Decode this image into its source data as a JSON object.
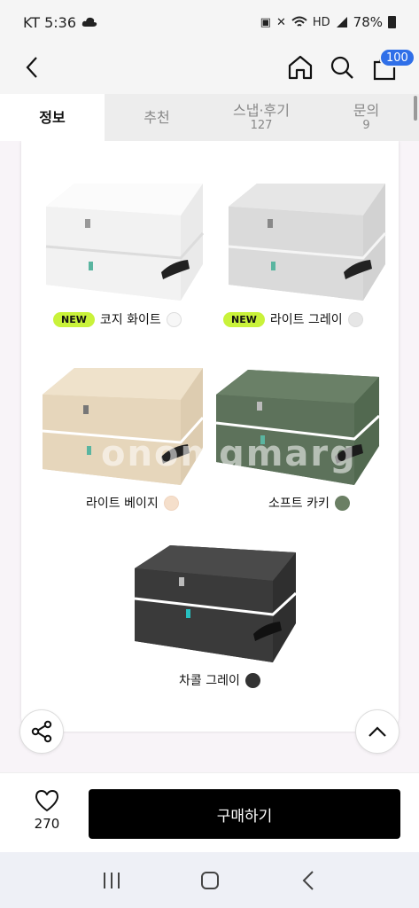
{
  "status": {
    "carrier_time": "KT 5:36",
    "battery_pct": "78%"
  },
  "header": {
    "cart_badge": "100"
  },
  "tabs": [
    {
      "label": "정보",
      "count": ""
    },
    {
      "label": "추천",
      "count": ""
    },
    {
      "label": "스냅·후기",
      "count": "127"
    },
    {
      "label": "문의",
      "count": "9"
    }
  ],
  "watermark": "onomgmarg",
  "products": [
    {
      "new": "NEW",
      "name": "코지 화이트",
      "color": "#f7f7f7",
      "body": "#f1f1f1",
      "top": "#fafafa"
    },
    {
      "new": "NEW",
      "name": "라이트 그레이",
      "color": "#e6e6e6",
      "body": "#d6d6d6",
      "top": "#e2e2e2"
    },
    {
      "new": "",
      "name": "라이트 베이지",
      "color": "#f5dfcb",
      "body": "#e6d6bb",
      "top": "#efe2cb"
    },
    {
      "new": "",
      "name": "소프트 카키",
      "color": "#6b7f64",
      "body": "#5d725b",
      "top": "#6a8067"
    },
    {
      "new": "",
      "name": "차콜 그레이",
      "color": "#333333",
      "body": "#3a3a3a",
      "top": "#4a4a4a"
    }
  ],
  "action": {
    "like_count": "270",
    "buy_label": "구매하기"
  }
}
